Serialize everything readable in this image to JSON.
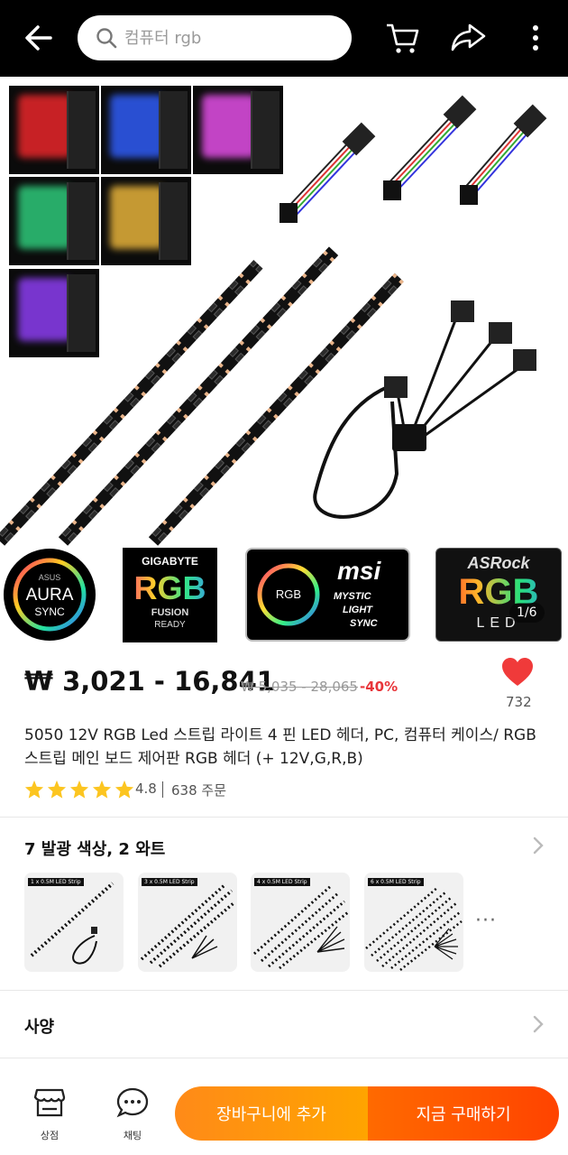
{
  "header": {
    "search_placeholder": "컴퓨터 rgb",
    "icons": [
      "back-arrow-icon",
      "search-icon",
      "cart-icon",
      "share-icon",
      "more-vertical-icon"
    ]
  },
  "gallery": {
    "pager": "1/6",
    "thumb_colors": [
      "#e8262a",
      "#2f5cf5",
      "#e24ee6",
      "#2ec97a",
      "#e6b23a",
      "#8b3df0"
    ],
    "logos": {
      "asus_line1": "AURA",
      "asus_line2": "SYNC",
      "asus_brand": "ASUS",
      "gigabyte_brand": "GIGABYTE",
      "gigabyte_big": "RGB",
      "gigabyte_line1": "FUSION",
      "gigabyte_line2": "READY",
      "msi_brand": "msi",
      "msi_ring": "RGB",
      "msi_line1": "MYSTIC",
      "msi_line2": "LIGHT",
      "msi_line3": "SYNC",
      "asrock_brand": "ASRock",
      "asrock_big": "RGB",
      "asrock_led": "LED"
    }
  },
  "product": {
    "price": "₩ 3,021 - 16,841",
    "old_price": "₩ 5,035 - 28,065",
    "discount": "-40%",
    "likes": "732",
    "title": "5050 12V RGB Led 스트립 라이트 4 핀 LED 헤더, PC, 컴퓨터 케이스/ RGB 스트립 메인 보드 제어판 RGB 헤더 (+ 12V,G,R,B)",
    "rating": "4.8",
    "rating_value": 4.8,
    "orders": "638 주문"
  },
  "variants": {
    "title": "7 발광 색상, 2 와트",
    "items": [
      {
        "label": "1 x 0.5M LED Strip"
      },
      {
        "label": "3 x 0.5M LED Strip"
      },
      {
        "label": "4 x 0.5M LED Strip"
      },
      {
        "label": "6 x 0.5M LED Strip"
      }
    ],
    "more": "···"
  },
  "specs": {
    "title": "사양"
  },
  "bottom_bar": {
    "store": "상점",
    "chat": "채팅",
    "add_to_cart": "장바구니에 추가",
    "buy_now": "지금 구매하기"
  },
  "colors": {
    "accent_orange": "#ff9a0f",
    "buy_red": "#ff4a00",
    "discount_red": "#e8353a",
    "heart_red": "#f03a3a",
    "star_yellow": "#fcc520"
  }
}
